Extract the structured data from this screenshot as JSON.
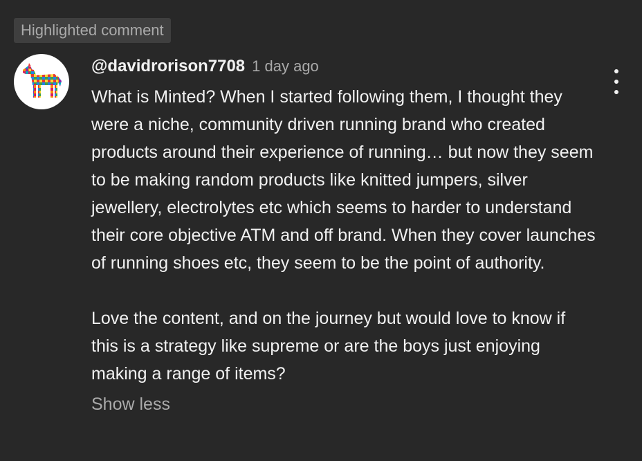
{
  "badge": {
    "label": "Highlighted comment"
  },
  "comment": {
    "author": "@davidrorison7708",
    "time": "1 day ago",
    "paragraphs": [
      "What is Minted? When I started following them, I thought they were a niche, community driven running brand who created products around their experience of running… but now they seem to be making random products like knitted jumpers, silver jewellery, electrolytes etc which seems to harder to understand their core objective ATM and off brand. When they cover launches of running shoes etc, they seem to be the point of authority.",
      "Love the content, and on the journey but would love to know if this is a strategy like supreme or are the boys just enjoying making a range of items?"
    ],
    "show_less_label": "Show less",
    "avatar_icon": "patchwork-horse-icon",
    "menu_icon": "more-vert-icon"
  },
  "colors": {
    "background": "#282828",
    "badge_background": "#3f3f3f",
    "secondary_text": "#aaaaaa",
    "primary_text": "#f1f1f1"
  }
}
